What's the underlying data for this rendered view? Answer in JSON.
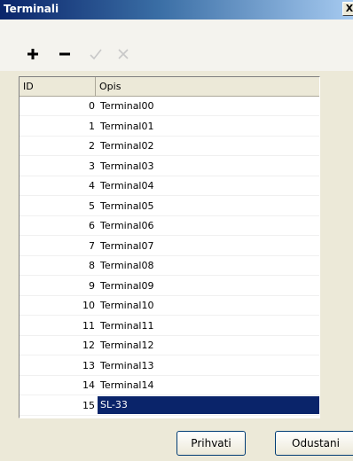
{
  "window": {
    "title": "Terminali",
    "close_glyph": "X"
  },
  "toolbar": {
    "buttons": [
      {
        "name": "add",
        "icon": "plus-icon",
        "enabled": true
      },
      {
        "name": "remove",
        "icon": "minus-icon",
        "enabled": true
      },
      {
        "name": "confirm",
        "icon": "check-icon",
        "enabled": false
      },
      {
        "name": "cancel",
        "icon": "x-icon",
        "enabled": false
      }
    ]
  },
  "grid": {
    "columns": [
      "ID",
      "Opis"
    ],
    "rows": [
      {
        "id": "0",
        "opis": "Terminal00"
      },
      {
        "id": "1",
        "opis": "Terminal01"
      },
      {
        "id": "2",
        "opis": "Terminal02"
      },
      {
        "id": "3",
        "opis": "Terminal03"
      },
      {
        "id": "4",
        "opis": "Terminal04"
      },
      {
        "id": "5",
        "opis": "Terminal05"
      },
      {
        "id": "6",
        "opis": "Terminal06"
      },
      {
        "id": "7",
        "opis": "Terminal07"
      },
      {
        "id": "8",
        "opis": "Terminal08"
      },
      {
        "id": "9",
        "opis": "Terminal09"
      },
      {
        "id": "10",
        "opis": "Terminal10"
      },
      {
        "id": "11",
        "opis": "Terminal11"
      },
      {
        "id": "12",
        "opis": "Terminal12"
      },
      {
        "id": "13",
        "opis": "Terminal13"
      },
      {
        "id": "14",
        "opis": "Terminal14"
      },
      {
        "id": "15",
        "opis": "SL-33"
      }
    ],
    "selected_row": 15
  },
  "footer": {
    "accept_label": "Prihvati",
    "cancel_label": "Odustani"
  },
  "colors": {
    "selection": "#0a246a",
    "title_bar": "#0a246a"
  }
}
